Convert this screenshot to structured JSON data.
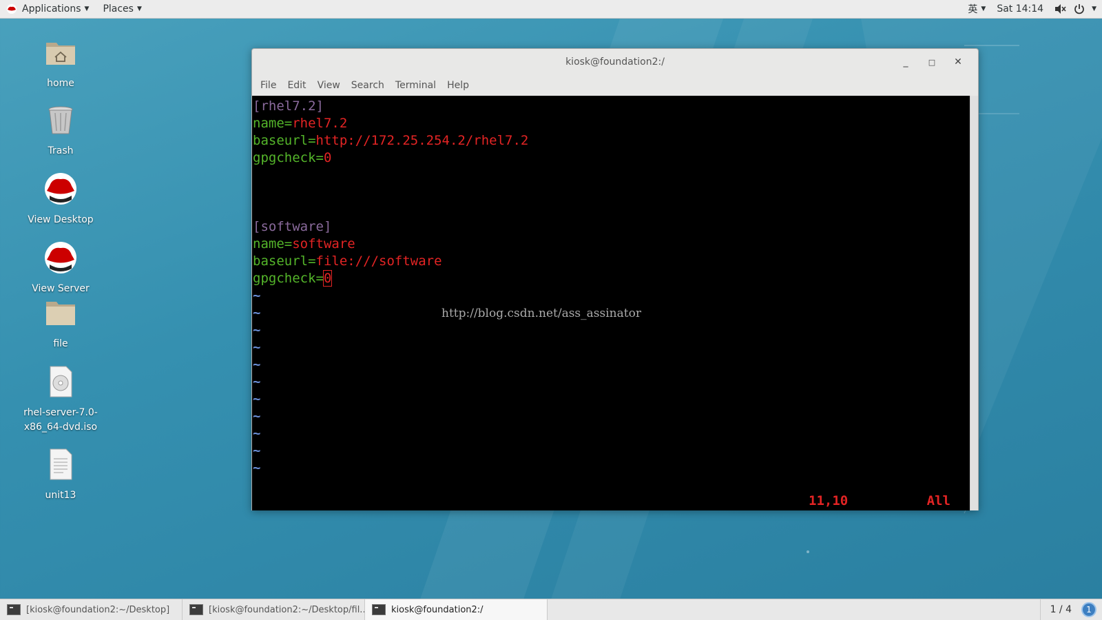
{
  "topbar": {
    "applications": "Applications",
    "places": "Places",
    "input_method": "英",
    "clock": "Sat 14:14",
    "volume_icon": "speaker-muted-icon",
    "power_icon": "power-icon"
  },
  "desktop": {
    "icons": [
      {
        "label": "home",
        "icon": "home-folder-icon"
      },
      {
        "label": "Trash",
        "icon": "trash-icon"
      },
      {
        "label": "View Desktop",
        "icon": "redhat-icon"
      },
      {
        "label": "View Server",
        "icon": "redhat-icon"
      },
      {
        "label": "file",
        "icon": "folder-icon"
      },
      {
        "label": "rhel-server-7.0-x86_64-dvd.iso",
        "icon": "disc-image-icon"
      },
      {
        "label": "unit13",
        "icon": "text-file-icon"
      }
    ]
  },
  "window": {
    "title": "kiosk@foundation2:/",
    "menu": [
      "File",
      "Edit",
      "View",
      "Search",
      "Terminal",
      "Help"
    ]
  },
  "editor": {
    "s1_header": "[rhel7.2]",
    "s1_name_key": "name=",
    "s1_name_val": "rhel7.2",
    "s1_baseurl_key": "baseurl=",
    "s1_baseurl_val": "http://172.25.254.2/rhel7.2",
    "s1_gpg_key": "gpgcheck=",
    "s1_gpg_val": "0",
    "s2_header": "[software]",
    "s2_name_key": "name=",
    "s2_name_val": "software",
    "s2_baseurl_key": "baseurl=",
    "s2_baseurl_val": "file:///software",
    "s2_gpg_key": "gpgcheck=",
    "s2_gpg_val": "0",
    "tilde": "~",
    "status_position": "11,10",
    "status_scroll": "All",
    "watermark": "http://blog.csdn.net/ass_assinator"
  },
  "taskbar": {
    "tasks": [
      "[kiosk@foundation2:~/Desktop]",
      "[kiosk@foundation2:~/Desktop/fil...",
      "kiosk@foundation2:/"
    ],
    "workspace": "1 / 4",
    "notification_count": "1"
  }
}
